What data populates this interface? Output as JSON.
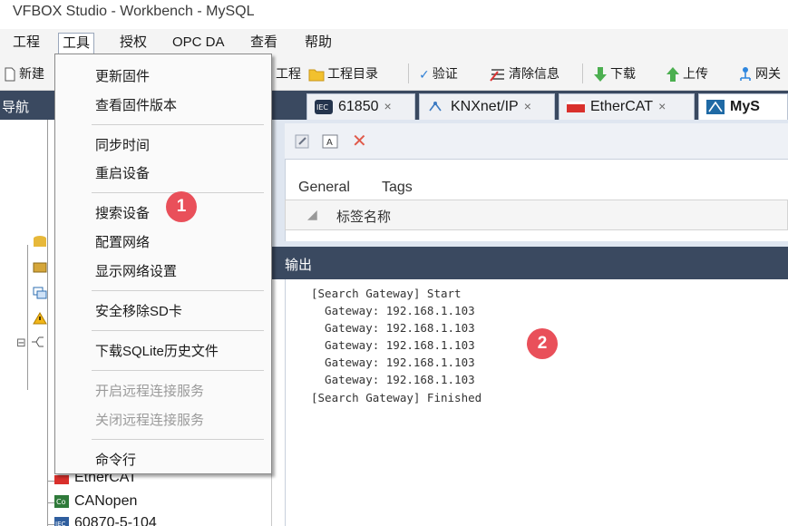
{
  "window": {
    "title": "VFBOX Studio - Workbench - MySQL"
  },
  "menubar": {
    "items": [
      {
        "label": "工程"
      },
      {
        "label": "工具"
      },
      {
        "label": "授权"
      },
      {
        "label": "OPC DA"
      },
      {
        "label": "查看"
      },
      {
        "label": "帮助"
      }
    ]
  },
  "toolbar": {
    "new_label": "新建",
    "project_label": "工程",
    "project_dir_label": "工程目录",
    "verify_label": "验证",
    "clear_label": "清除信息",
    "download_label": "下载",
    "upload_label": "上传",
    "gateway_label": "网关"
  },
  "nav": {
    "title": "导航",
    "tree_visible": [
      "EtherCAT",
      "CANopen",
      "60870-5-104"
    ]
  },
  "doc_tabs": [
    {
      "label": "61850",
      "close": "×"
    },
    {
      "label": "KNXnet/IP",
      "close": "×"
    },
    {
      "label": "EtherCAT",
      "close": "×"
    },
    {
      "label": "MyS"
    }
  ],
  "doc": {
    "subtabs": [
      "General",
      "Tags"
    ],
    "column_header": "标签名称"
  },
  "tools_menu": {
    "items": [
      {
        "label": "更新固件",
        "enabled": true
      },
      {
        "label": "查看固件版本",
        "enabled": true
      },
      {
        "label": "同步时间",
        "enabled": true
      },
      {
        "label": "重启设备",
        "enabled": true
      },
      {
        "label": "搜索设备",
        "enabled": true
      },
      {
        "label": "配置网络",
        "enabled": true
      },
      {
        "label": "显示网络设置",
        "enabled": true
      },
      {
        "label": "安全移除SD卡",
        "enabled": true
      },
      {
        "label": "下载SQLite历史文件",
        "enabled": true
      },
      {
        "label": "开启远程连接服务",
        "enabled": false
      },
      {
        "label": "关闭远程连接服务",
        "enabled": false
      },
      {
        "label": "命令行",
        "enabled": true
      }
    ]
  },
  "output": {
    "title": "输出",
    "lines": [
      "[Search Gateway] Start",
      "  Gateway: 192.168.1.103",
      "  Gateway: 192.168.1.103",
      "  Gateway: 192.168.1.103",
      "  Gateway: 192.168.1.103",
      "  Gateway: 192.168.1.103",
      "[Search Gateway] Finished"
    ]
  },
  "annotations": {
    "step1": "1",
    "step2": "2"
  },
  "colors": {
    "panel_header": "#3a4960",
    "badge": "#e9505a",
    "menu_bg": "#fafafa"
  }
}
